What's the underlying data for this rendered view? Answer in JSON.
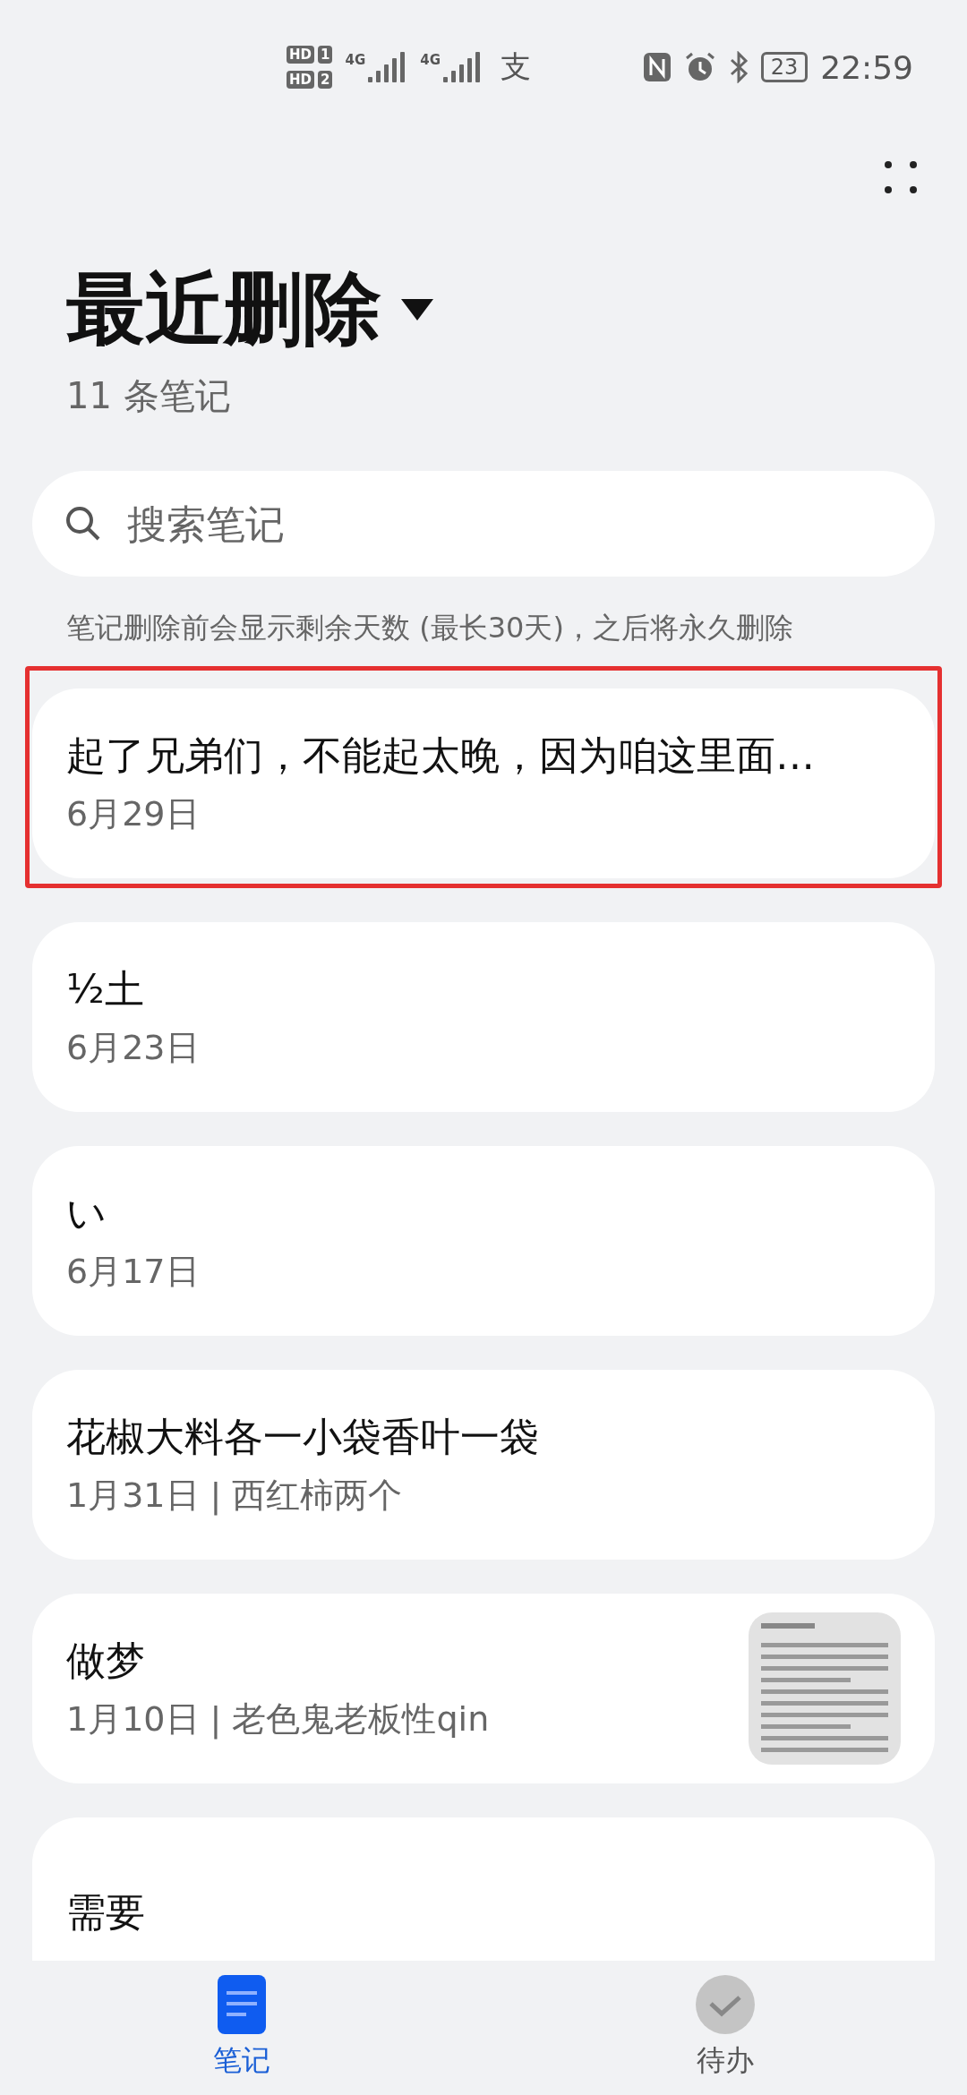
{
  "status_bar": {
    "sims": [
      {
        "hd": "HD",
        "slot": "1"
      },
      {
        "hd": "HD",
        "slot": "2"
      }
    ],
    "networks": [
      "4G",
      "4G"
    ],
    "app_glyph": "支",
    "battery": "23",
    "time": "22:59"
  },
  "header": {
    "title": "最近删除",
    "count": "11 条笔记"
  },
  "search": {
    "placeholder": "搜索笔记"
  },
  "notice": "笔记删除前会显示剩余天数 (最长30天)，之后将永久删除",
  "notes": [
    {
      "title": "起了兄弟们，不能起太晚，因为咱这里面…",
      "date": "6月29日",
      "highlighted": true
    },
    {
      "title": "½土",
      "date": "6月23日",
      "highlighted": false
    },
    {
      "title": "い",
      "date": "6月17日",
      "highlighted": false
    },
    {
      "title": "花椒大料各一小袋香叶一袋",
      "date": "1月31日 | 西红柿两个",
      "highlighted": false
    },
    {
      "title": "做梦",
      "date": "1月10日 | 老色鬼老板性qin",
      "highlighted": false
    },
    {
      "title": "需要",
      "highlighted": false
    }
  ],
  "tabs": [
    {
      "label": "笔记",
      "selected": true
    },
    {
      "label": "待办",
      "selected": false
    }
  ]
}
